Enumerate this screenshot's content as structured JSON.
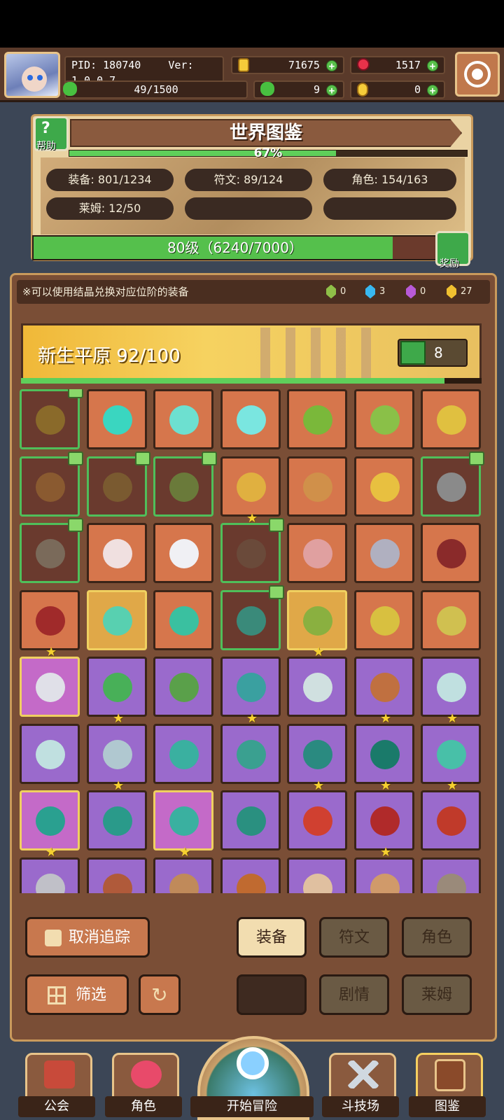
{
  "header": {
    "pid": "PID: 180740",
    "ver": "Ver: 1.0.0.7",
    "coins": "71675",
    "gems": "1517",
    "stamina": "49/1500",
    "clover": "9",
    "keys": "0"
  },
  "encyclopedia": {
    "title": "世界图鉴",
    "help_label": "帮助",
    "progress_text": "67%",
    "progress": 0.67,
    "stats": [
      "装备: 801/1234",
      "符文: 89/124",
      "角色: 154/163",
      "莱姆: 12/50",
      "",
      ""
    ],
    "level_text": "80级（6240/7000）",
    "level_progress": 0.8914,
    "reward_label": "奖励"
  },
  "notice": {
    "text": "※可以使用结晶兑换对应位阶的装备",
    "crystals": [
      {
        "color": "#8fbf48",
        "count": "0"
      },
      {
        "color": "#38b8f0",
        "count": "3"
      },
      {
        "color": "#b85ad8",
        "count": "0"
      },
      {
        "color": "#f0c030",
        "count": "27"
      }
    ]
  },
  "region": {
    "name": "新生平原  92/100",
    "progress": 0.92,
    "likes": "8"
  },
  "items": [
    {
      "bg": "dark",
      "color": "#8a6a2a",
      "fav": true,
      "star": false
    },
    {
      "bg": "orange",
      "color": "#3ad6c0",
      "fav": false,
      "star": false
    },
    {
      "bg": "orange",
      "color": "#6de0d0",
      "fav": false,
      "star": false
    },
    {
      "bg": "orange",
      "color": "#7ae6e0",
      "fav": false,
      "star": false
    },
    {
      "bg": "orange",
      "color": "#7ab83a",
      "fav": false,
      "star": false
    },
    {
      "bg": "orange",
      "color": "#8ac048",
      "fav": false,
      "star": false
    },
    {
      "bg": "orange",
      "color": "#e0c040",
      "fav": false,
      "star": false
    },
    {
      "bg": "dark",
      "color": "#8a5a30",
      "fav": true,
      "star": false
    },
    {
      "bg": "dark",
      "color": "#7a5a30",
      "fav": true,
      "star": false
    },
    {
      "bg": "dark",
      "color": "#6a7a3a",
      "fav": true,
      "star": false
    },
    {
      "bg": "orange",
      "color": "#e0b040",
      "fav": false,
      "star": true
    },
    {
      "bg": "orange",
      "color": "#d0904a",
      "fav": false,
      "star": false
    },
    {
      "bg": "orange",
      "color": "#e8c040",
      "fav": false,
      "star": false
    },
    {
      "bg": "dark",
      "color": "#8a8a8a",
      "fav": true,
      "star": false
    },
    {
      "bg": "dark",
      "color": "#7a6a5a",
      "fav": true,
      "star": false
    },
    {
      "bg": "orange",
      "color": "#f0e0e0",
      "fav": false,
      "star": false
    },
    {
      "bg": "orange",
      "color": "#f0f0f4",
      "fav": false,
      "star": false
    },
    {
      "bg": "dark",
      "color": "#6a4a3a",
      "fav": true,
      "star": false
    },
    {
      "bg": "orange",
      "color": "#e0a0a0",
      "fav": false,
      "star": false
    },
    {
      "bg": "orange",
      "color": "#b0b0c0",
      "fav": false,
      "star": false
    },
    {
      "bg": "orange",
      "color": "#8a2a2a",
      "fav": false,
      "star": false
    },
    {
      "bg": "orange",
      "color": "#a02a2a",
      "fav": false,
      "star": true
    },
    {
      "bg": "gold",
      "color": "#58d0b0",
      "fav": false,
      "star": false
    },
    {
      "bg": "orange",
      "color": "#3ac0a0",
      "fav": false,
      "star": false
    },
    {
      "bg": "dark",
      "color": "#3a8a7a",
      "fav": true,
      "star": false
    },
    {
      "bg": "gold",
      "color": "#8ab040",
      "fav": false,
      "star": true
    },
    {
      "bg": "orange",
      "color": "#d8c040",
      "fav": false,
      "star": false
    },
    {
      "bg": "orange",
      "color": "#d0c050",
      "fav": false,
      "star": false
    },
    {
      "bg": "pink",
      "color": "#e0e0e8",
      "fav": false,
      "star": false
    },
    {
      "bg": "purple",
      "color": "#48b058",
      "fav": false,
      "star": true
    },
    {
      "bg": "purple",
      "color": "#5aa04a",
      "fav": false,
      "star": false
    },
    {
      "bg": "purple",
      "color": "#3aa0a0",
      "fav": false,
      "star": true
    },
    {
      "bg": "purple",
      "color": "#d0e0e0",
      "fav": false,
      "star": false
    },
    {
      "bg": "purple",
      "color": "#c07040",
      "fav": false,
      "star": true
    },
    {
      "bg": "purple",
      "color": "#c0e0e0",
      "fav": false,
      "star": true
    },
    {
      "bg": "purple",
      "color": "#c0e0e0",
      "fav": false,
      "star": false
    },
    {
      "bg": "purple",
      "color": "#b0c8d0",
      "fav": false,
      "star": true
    },
    {
      "bg": "purple",
      "color": "#3ab0a0",
      "fav": false,
      "star": false
    },
    {
      "bg": "purple",
      "color": "#3aa090",
      "fav": false,
      "star": false
    },
    {
      "bg": "purple",
      "color": "#2a8a80",
      "fav": false,
      "star": true
    },
    {
      "bg": "purple",
      "color": "#1a7a6a",
      "fav": false,
      "star": true
    },
    {
      "bg": "purple",
      "color": "#48c0a8",
      "fav": false,
      "star": true
    },
    {
      "bg": "pink",
      "color": "#2aa090",
      "fav": false,
      "star": true
    },
    {
      "bg": "purple",
      "color": "#2a9a8a",
      "fav": false,
      "star": false
    },
    {
      "bg": "pink",
      "color": "#3ab0a0",
      "fav": false,
      "star": true
    },
    {
      "bg": "purple",
      "color": "#2a9080",
      "fav": false,
      "star": false
    },
    {
      "bg": "purple",
      "color": "#d04030",
      "fav": false,
      "star": false
    },
    {
      "bg": "purple",
      "color": "#b02a2a",
      "fav": false,
      "star": true
    },
    {
      "bg": "purple",
      "color": "#c03a2a",
      "fav": false,
      "star": false
    },
    {
      "bg": "purple",
      "color": "#c0c0c8",
      "fav": false,
      "star": false
    },
    {
      "bg": "purple",
      "color": "#b05a3a",
      "fav": false,
      "star": false
    },
    {
      "bg": "purple",
      "color": "#c08a5a",
      "fav": false,
      "star": false
    },
    {
      "bg": "purple",
      "color": "#c06a30",
      "fav": false,
      "star": false
    },
    {
      "bg": "purple",
      "color": "#e0c0a0",
      "fav": false,
      "star": false
    },
    {
      "bg": "purple",
      "color": "#d09a6a",
      "fav": false,
      "star": false
    },
    {
      "bg": "purple",
      "color": "#9a8a7a",
      "fav": false,
      "star": false
    }
  ],
  "controls": {
    "untrack": "取消追踪",
    "filter": "筛选",
    "tab_equipment": "装备",
    "tab_rune": "符文",
    "tab_character": "角色",
    "tab_story": "剧情",
    "tab_slime": "莱姆"
  },
  "nav": {
    "guild": "公会",
    "character": "角色",
    "adventure": "开始冒险",
    "arena": "斗技场",
    "encyclopedia": "图鉴"
  }
}
